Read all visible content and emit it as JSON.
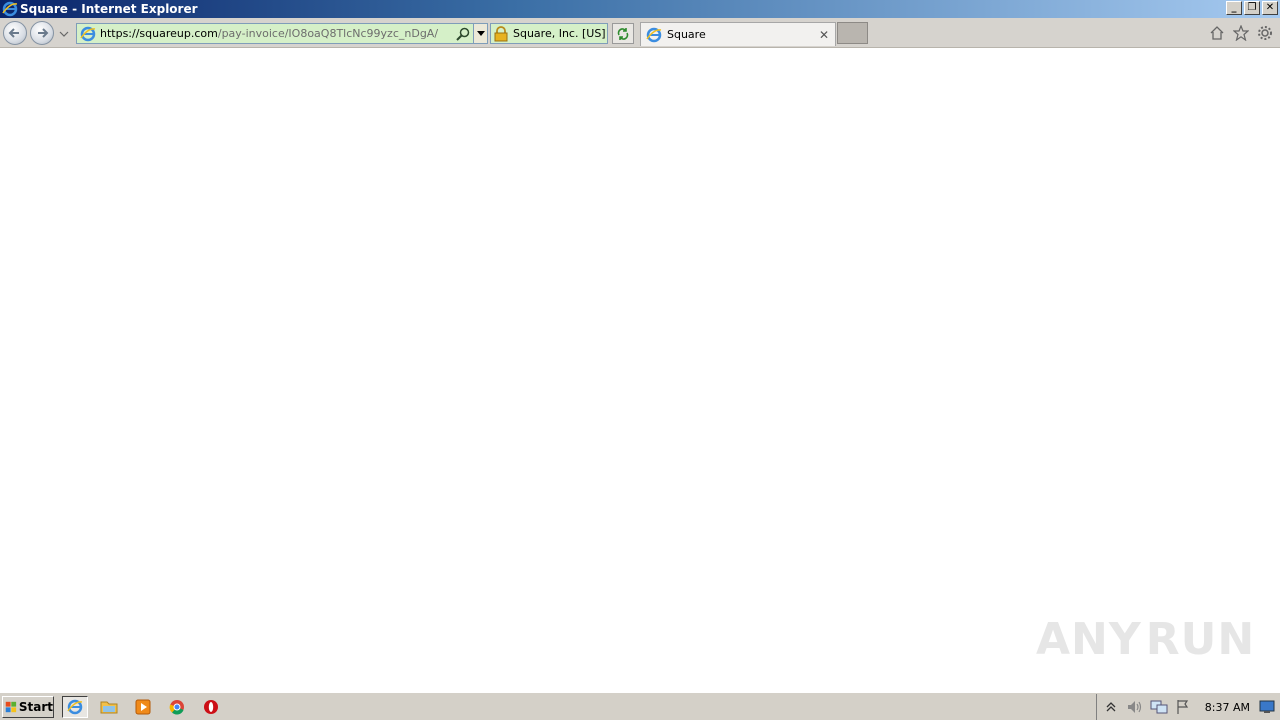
{
  "window": {
    "title": "Square - Internet Explorer",
    "min_label": "_",
    "restore_label": "❐",
    "close_label": "✕"
  },
  "address": {
    "host": "https://squareup.com",
    "path": "/pay-invoice/IO8oaQ8TlcNc99yzc_nDgA/"
  },
  "certificate": {
    "label": "Square, Inc. [US]"
  },
  "tab": {
    "label": "Square",
    "close_label": "✕"
  },
  "taskbar": {
    "start_label": "Start",
    "clock": "8:37 AM"
  },
  "watermark": {
    "left": "ANY",
    "right": "RUN"
  },
  "colors": {
    "address_bg": "#d5f0c8",
    "titlebar_start": "#0a246a",
    "titlebar_end": "#a6caf0"
  }
}
